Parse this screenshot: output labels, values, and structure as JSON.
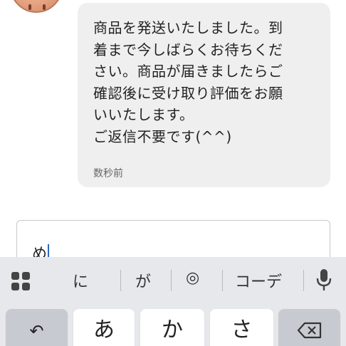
{
  "chat": {
    "message": "商品を発送いたしました。到\n着まで今しばらくお待ちくだ\nさい。商品が届きましたらご\n確認後に受け取り評価をお願\nいいたします。\nご返信不要です(^^)",
    "time": "数秒前"
  },
  "composer": {
    "value": "め"
  },
  "keyboard": {
    "suggestions": [
      "に",
      "が",
      "◎",
      "コーデ"
    ],
    "keys": [
      "あ",
      "か",
      "さ"
    ],
    "undo_glyph": "↶",
    "icons": {
      "menu": "grid-icon",
      "voice": "mic-icon",
      "undo": "undo-icon",
      "delete": "backspace-icon"
    }
  }
}
